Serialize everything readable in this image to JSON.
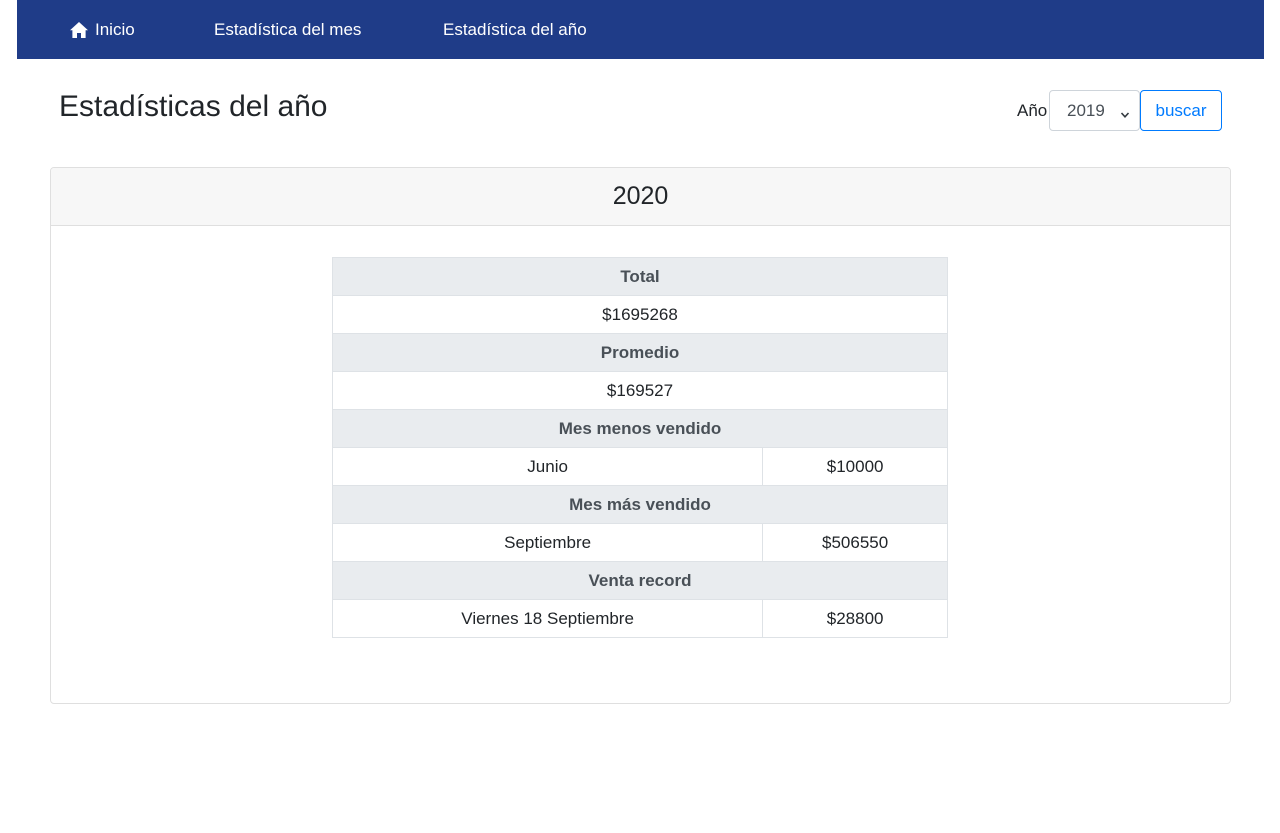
{
  "navbar": {
    "items": [
      {
        "label": "Inicio",
        "icon": "home-icon"
      },
      {
        "label": "Estadística del mes"
      },
      {
        "label": "Estadística del año"
      }
    ],
    "background": "#1f3c88"
  },
  "page": {
    "title": "Estadísticas del año"
  },
  "search": {
    "year_label": "Año",
    "selected_year": "2019",
    "button_label": "buscar"
  },
  "card": {
    "header": "2020"
  },
  "stats": {
    "total_label": "Total",
    "total_value": "$1695268",
    "average_label": "Promedio",
    "average_value": "$169527",
    "least_sold_label": "Mes menos vendido",
    "least_sold_month": "Junio",
    "least_sold_amount": "$10000",
    "most_sold_label": "Mes más vendido",
    "most_sold_month": "Septiembre",
    "most_sold_amount": "$506550",
    "record_label": "Venta record",
    "record_date": "Viernes 18 Septiembre",
    "record_amount": "$28800"
  },
  "colors": {
    "accent": "#007bff",
    "table_header_bg": "#e9ecef",
    "card_header_bg": "#f7f7f7"
  }
}
